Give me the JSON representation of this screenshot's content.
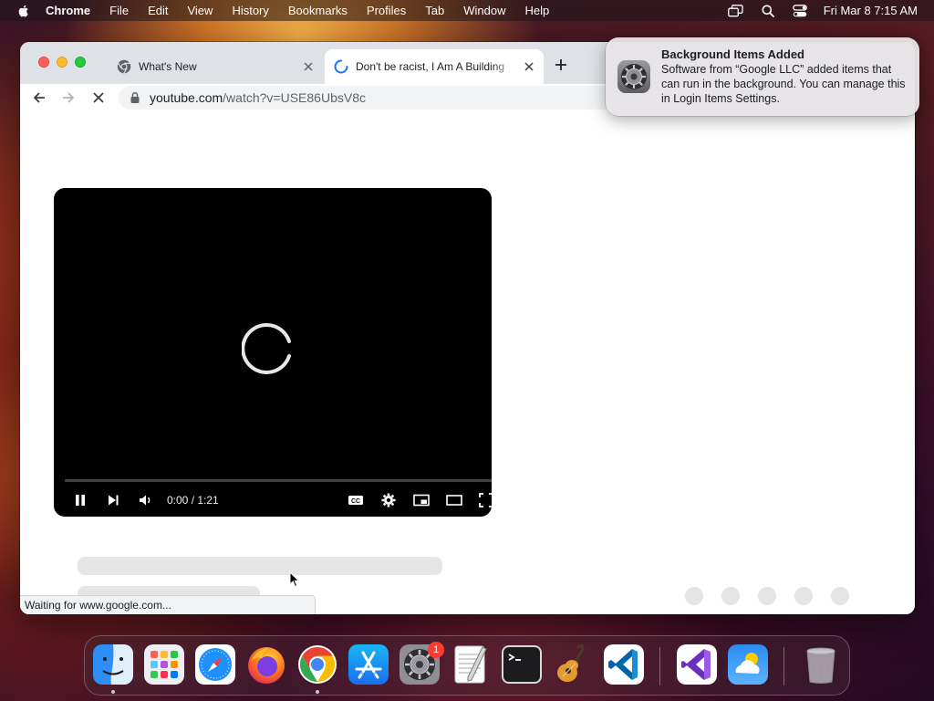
{
  "menubar": {
    "app_name": "Chrome",
    "items": [
      "File",
      "Edit",
      "View",
      "History",
      "Bookmarks",
      "Profiles",
      "Tab",
      "Window",
      "Help"
    ],
    "clock": "Fri Mar 8  7:15 AM"
  },
  "browser": {
    "tabs": [
      {
        "title": "What's New",
        "active": false
      },
      {
        "title": "Don't be racist, I Am A Building",
        "active": true,
        "loading": true
      }
    ],
    "url_host": "youtube.com",
    "url_path": "/watch?v=USE86UbsV8c",
    "status_text": "Waiting for www.google.com..."
  },
  "player": {
    "time": "0:00 / 1:21",
    "state": "buffering",
    "played_fraction": 0
  },
  "notification": {
    "title": "Background Items Added",
    "body": "Software from “Google LLC” added items that can run in the background. You can manage this in Login Items Settings.",
    "icon": "system-settings-gear-icon"
  },
  "dock": {
    "apps": [
      "Finder",
      "Launchpad",
      "Safari",
      "Firefox",
      "Google Chrome",
      "App Store",
      "System Settings",
      "TextEdit",
      "Terminal",
      "GarageBand",
      "Visual Studio Code",
      "Visual Studio",
      "Weather",
      "Trash"
    ],
    "running": [
      "Finder",
      "Google Chrome"
    ],
    "system_settings_badge": "1"
  },
  "colors": {
    "chrome_tabstrip": "#dee1e6",
    "youtube_player_bg": "#000000",
    "notification_bg": "#e6e4e6",
    "badge_red": "#ff3b30"
  }
}
